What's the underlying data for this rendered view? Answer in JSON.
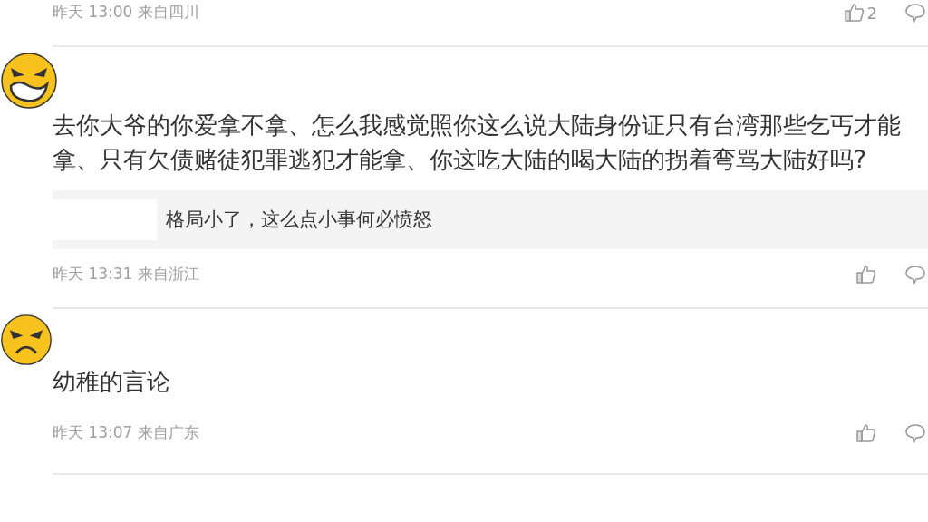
{
  "comments": [
    {
      "time": "昨天 13:00 来自四川",
      "likes": "2"
    },
    {
      "avatar": {
        "kind": "grin"
      },
      "text": "去你大爷的你爱拿不拿、怎么我感觉照你这么说大陆身份证只有台湾那些乞丐才能拿、只有欠债赌徒犯罪逃犯才能拿、你这吃大陆的喝大陆的拐着弯骂大陆好吗?",
      "reply": "格局小了，这么点小事何必愤怒",
      "time": "昨天 13:31 来自浙江"
    },
    {
      "avatar": {
        "kind": "angry"
      },
      "text": "幼稚的言论",
      "time": "昨天 13:07 来自广东"
    }
  ]
}
